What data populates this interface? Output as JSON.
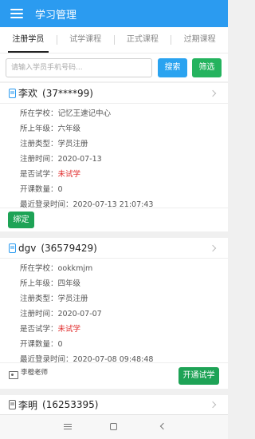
{
  "app": {
    "title": "学习管理"
  },
  "tabs": [
    {
      "label": "注册学员"
    },
    {
      "label": "试学课程"
    },
    {
      "label": "正式课程"
    },
    {
      "label": "过期课程"
    }
  ],
  "search": {
    "placeholder": "请输入学员手机号码...",
    "search_label": "搜索",
    "filter_label": "筛选"
  },
  "labels": {
    "school": "所在学校：",
    "grade": "所上年级：",
    "type": "注册类型：",
    "reg_time": "注册时间：",
    "trial": "是否试学：",
    "course_count": "开课数量：",
    "last_login": "最近登录时间："
  },
  "students": [
    {
      "name": "李欢",
      "phone": "(37****99)",
      "school": "记忆王速记中心",
      "grade": "六年级",
      "type": "学员注册",
      "reg_time": "2020-07-13",
      "trial": "未试学",
      "course_count": "0",
      "last_login": "2020-07-13 21:07:43",
      "action": "绑定"
    },
    {
      "name": "dgv",
      "phone": "(36579429)",
      "school": "ookkmjm",
      "grade": "四年级",
      "type": "学员注册",
      "reg_time": "2020-07-07",
      "trial": "未试学",
      "course_count": "0",
      "last_login": "2020-07-08 09:48:48",
      "teacher": "李橙老师",
      "action": "开通试学"
    },
    {
      "name": "李明",
      "phone": "(16253395)"
    }
  ],
  "colors": {
    "primary": "#2b9bf0",
    "green": "#1ea356",
    "red": "#e02a2a"
  }
}
